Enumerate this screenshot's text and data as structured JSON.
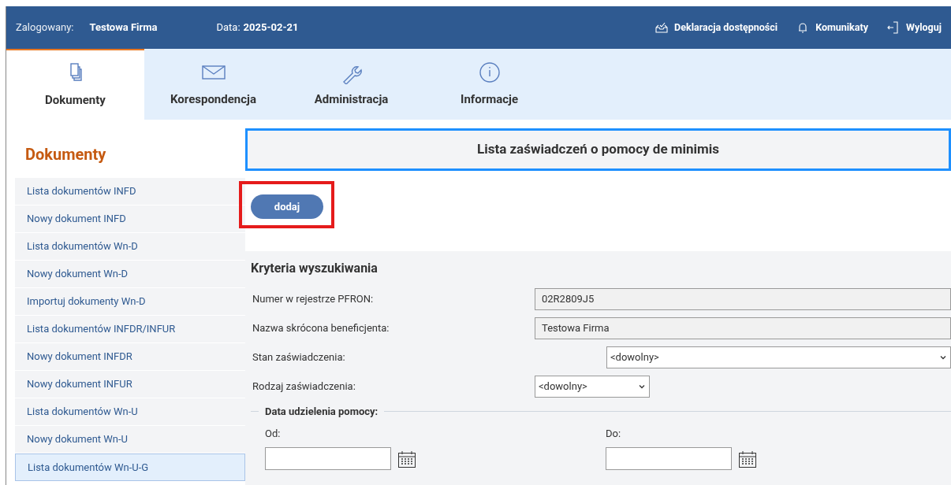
{
  "header": {
    "user_label": "Zalogowany:",
    "user_name": "Testowa Firma",
    "date_label": "Data:",
    "date_value": "2025-02-21",
    "links": [
      {
        "kind": "accessibility",
        "label": "Deklaracja dostępności"
      },
      {
        "kind": "notifications",
        "label": "Komunikaty"
      },
      {
        "kind": "logout",
        "label": "Wyloguj"
      }
    ]
  },
  "tabs": [
    {
      "kind": "documents",
      "label": "Dokumenty",
      "selected": true
    },
    {
      "kind": "mail",
      "label": "Korespondencja",
      "selected": false
    },
    {
      "kind": "admin",
      "label": "Administracja",
      "selected": false
    },
    {
      "kind": "info",
      "label": "Informacje",
      "selected": false
    }
  ],
  "sidebar": {
    "title": "Dokumenty",
    "items": [
      {
        "label": "Lista dokumentów INFD",
        "selected": false
      },
      {
        "label": "Nowy dokument INFD",
        "selected": false
      },
      {
        "label": "Lista dokumentów Wn-D",
        "selected": false
      },
      {
        "label": "Nowy dokument Wn-D",
        "selected": false
      },
      {
        "label": "Importuj dokumenty Wn-D",
        "selected": false
      },
      {
        "label": "Lista dokumentów INFDR/INFUR",
        "selected": false
      },
      {
        "label": "Nowy dokument INFDR",
        "selected": false
      },
      {
        "label": "Nowy dokument INFUR",
        "selected": false
      },
      {
        "label": "Lista dokumentów Wn-U",
        "selected": false
      },
      {
        "label": "Nowy dokument Wn-U",
        "selected": false
      },
      {
        "label": "Lista dokumentów Wn-U-G",
        "selected": true
      }
    ]
  },
  "main": {
    "title": "Lista zaświadczeń o pomocy de minimis",
    "add_button": "dodaj",
    "criteria": {
      "title": "Kryteria wyszukiwania",
      "fields": [
        {
          "kind": "text",
          "label": "Numer w rejestrze PFRON:",
          "value": "02R2809J5"
        },
        {
          "kind": "text",
          "label": "Nazwa skrócona beneficjenta:",
          "value": "Testowa Firma"
        },
        {
          "kind": "wide-select",
          "label": "Stan zaświadczenia:",
          "value": "<dowolny>"
        },
        {
          "kind": "select",
          "label": "Rodzaj zaświadczenia:",
          "value": "<dowolny>"
        }
      ],
      "date_group": {
        "legend": "Data udzielenia pomocy:",
        "from_label": "Od:",
        "to_label": "Do:"
      }
    }
  }
}
